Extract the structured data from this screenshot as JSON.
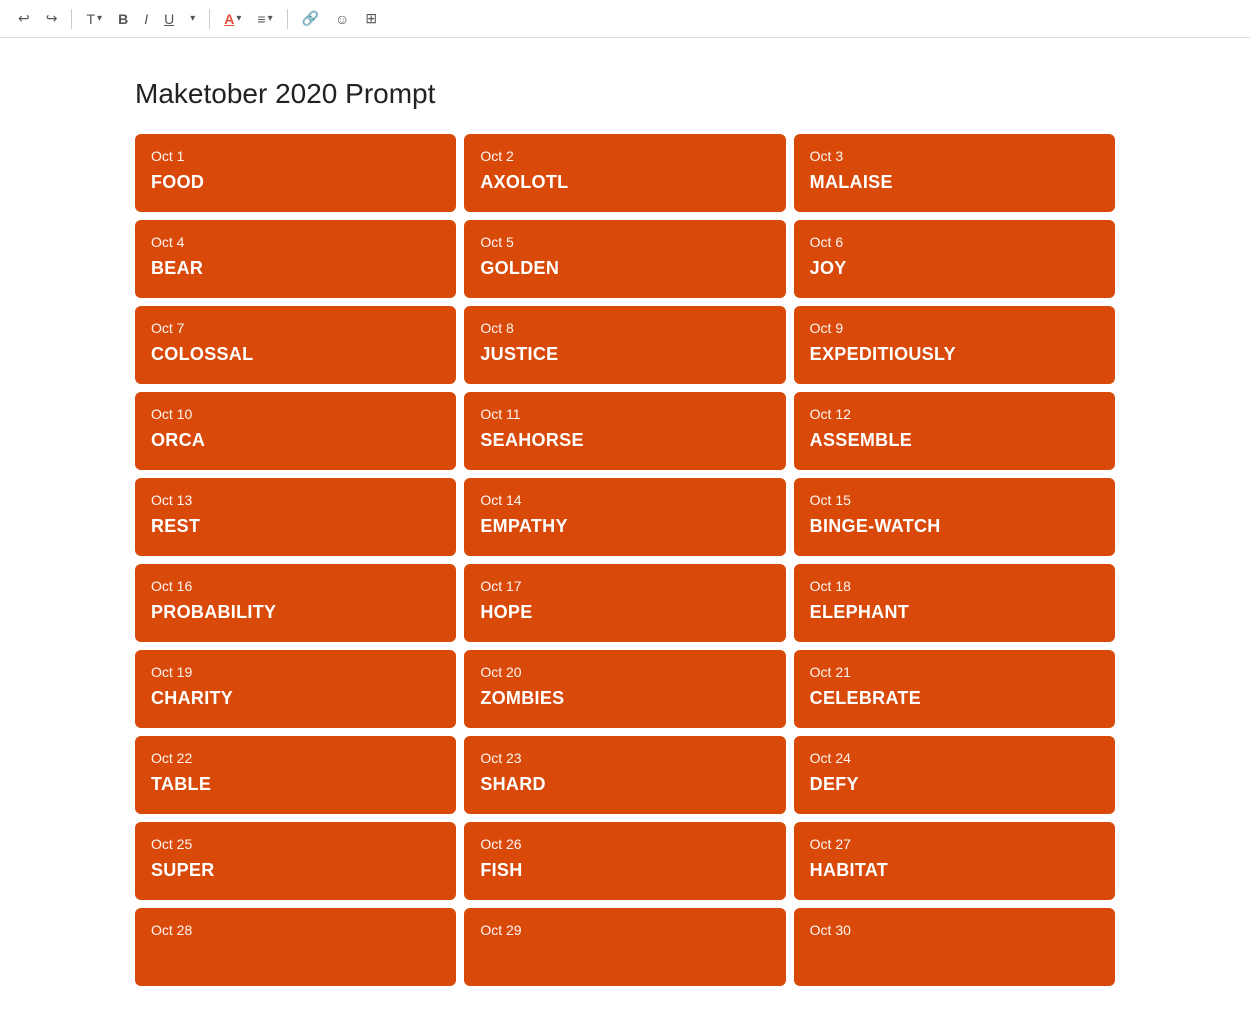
{
  "toolbar": {
    "undo_label": "↩",
    "redo_label": "↪",
    "text_label": "T",
    "bold_label": "B",
    "italic_label": "I",
    "underline_label": "U",
    "font_color_label": "A",
    "align_label": "≡",
    "link_label": "🔗",
    "emoji_label": "☺",
    "image_label": "⊞"
  },
  "page": {
    "title": "Maketober 2020 Prompt"
  },
  "prompts": [
    {
      "date": "Oct 1",
      "word": "FOOD"
    },
    {
      "date": "Oct 2",
      "word": "AXOLOTL"
    },
    {
      "date": "Oct 3",
      "word": "MALAISE"
    },
    {
      "date": "Oct 4",
      "word": "BEAR"
    },
    {
      "date": "Oct 5",
      "word": "GOLDEN"
    },
    {
      "date": "Oct 6",
      "word": "JOY"
    },
    {
      "date": "Oct 7",
      "word": "COLOSSAL"
    },
    {
      "date": "Oct 8",
      "word": "JUSTICE"
    },
    {
      "date": "Oct 9",
      "word": "EXPEDITIOUSLY"
    },
    {
      "date": "Oct 10",
      "word": "ORCA"
    },
    {
      "date": "Oct 11",
      "word": "SEAHORSE"
    },
    {
      "date": "Oct 12",
      "word": "ASSEMBLE"
    },
    {
      "date": "Oct 13",
      "word": "REST"
    },
    {
      "date": "Oct 14",
      "word": "EMPATHY"
    },
    {
      "date": "Oct 15",
      "word": "BINGE-WATCH"
    },
    {
      "date": "Oct 16",
      "word": "PROBABILITY"
    },
    {
      "date": "Oct 17",
      "word": "HOPE"
    },
    {
      "date": "Oct 18",
      "word": "ELEPHANT"
    },
    {
      "date": "Oct 19",
      "word": "CHARITY"
    },
    {
      "date": "Oct 20",
      "word": "ZOMBIES"
    },
    {
      "date": "Oct 21",
      "word": "CELEBRATE"
    },
    {
      "date": "Oct 22",
      "word": "TABLE"
    },
    {
      "date": "Oct 23",
      "word": "SHARD"
    },
    {
      "date": "Oct 24",
      "word": "DEFY"
    },
    {
      "date": "Oct 25",
      "word": "SUPER"
    },
    {
      "date": "Oct 26",
      "word": "FISH"
    },
    {
      "date": "Oct 27",
      "word": "HABITAT"
    },
    {
      "date": "Oct 28",
      "word": ""
    },
    {
      "date": "Oct 29",
      "word": ""
    },
    {
      "date": "Oct 30",
      "word": ""
    }
  ]
}
